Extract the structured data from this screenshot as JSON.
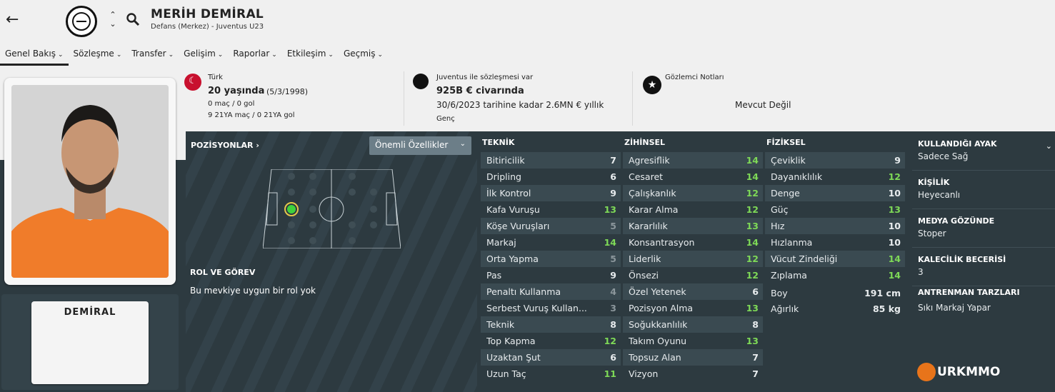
{
  "header": {
    "name": "MERİH DEMİRAL",
    "subtitle": "Defans (Merkez) - Juventus U23"
  },
  "tabs": [
    {
      "label": "Genel Bakış"
    },
    {
      "label": "Sözleşme"
    },
    {
      "label": "Transfer"
    },
    {
      "label": "Gelişim"
    },
    {
      "label": "Raporlar"
    },
    {
      "label": "Etkileşim"
    },
    {
      "label": "Geçmiş"
    }
  ],
  "nationality": {
    "country": "Türk",
    "age": "20 yaşında",
    "dob": "(5/3/1998)",
    "caps": "0 maç / 0 gol",
    "u21": "9 21YA maç / 0 21YA gol"
  },
  "contract": {
    "label": "Juventus ile sözleşmesi var",
    "value": "925B € civarında",
    "until": "30/6/2023 tarihine kadar 2.6MN € yıllık",
    "status": "Genç"
  },
  "scout": {
    "label": "Gözlemci Notları",
    "value": "Mevcut Değil"
  },
  "kit": {
    "name": "DEMİRAL"
  },
  "positions": {
    "title": "POZİSYONLAR",
    "dropdown": "Önemli Özellikler",
    "role_title": "ROL VE GÖREV",
    "role_text": "Bu mevkiye uygun bir rol yok"
  },
  "attributes": {
    "technical": {
      "title": "TEKNİK",
      "rows": [
        {
          "label": "Bitiricilik",
          "value": "7",
          "tone": "white"
        },
        {
          "label": "Dripling",
          "value": "6",
          "tone": "white"
        },
        {
          "label": "İlk Kontrol",
          "value": "9",
          "tone": "white"
        },
        {
          "label": "Kafa Vuruşu",
          "value": "13",
          "tone": "green"
        },
        {
          "label": "Köşe Vuruşları",
          "value": "5",
          "tone": "grey"
        },
        {
          "label": "Markaj",
          "value": "14",
          "tone": "green"
        },
        {
          "label": "Orta Yapma",
          "value": "5",
          "tone": "grey"
        },
        {
          "label": "Pas",
          "value": "9",
          "tone": "white"
        },
        {
          "label": "Penaltı Kullanma",
          "value": "4",
          "tone": "grey"
        },
        {
          "label": "Serbest Vuruş Kullan...",
          "value": "3",
          "tone": "grey"
        },
        {
          "label": "Teknik",
          "value": "8",
          "tone": "white"
        },
        {
          "label": "Top Kapma",
          "value": "12",
          "tone": "green"
        },
        {
          "label": "Uzaktan Şut",
          "value": "6",
          "tone": "white"
        },
        {
          "label": "Uzun Taç",
          "value": "11",
          "tone": "green"
        }
      ]
    },
    "mental": {
      "title": "ZİHİNSEL",
      "rows": [
        {
          "label": "Agresiflik",
          "value": "14",
          "tone": "green"
        },
        {
          "label": "Cesaret",
          "value": "14",
          "tone": "green"
        },
        {
          "label": "Çalışkanlık",
          "value": "12",
          "tone": "green"
        },
        {
          "label": "Karar Alma",
          "value": "12",
          "tone": "green"
        },
        {
          "label": "Kararlılık",
          "value": "13",
          "tone": "green"
        },
        {
          "label": "Konsantrasyon",
          "value": "14",
          "tone": "green"
        },
        {
          "label": "Liderlik",
          "value": "12",
          "tone": "green"
        },
        {
          "label": "Önsezi",
          "value": "12",
          "tone": "green"
        },
        {
          "label": "Özel Yetenek",
          "value": "6",
          "tone": "white"
        },
        {
          "label": "Pozisyon Alma",
          "value": "13",
          "tone": "green"
        },
        {
          "label": "Soğukkanlılık",
          "value": "8",
          "tone": "white"
        },
        {
          "label": "Takım Oyunu",
          "value": "13",
          "tone": "green"
        },
        {
          "label": "Topsuz Alan",
          "value": "7",
          "tone": "white"
        },
        {
          "label": "Vizyon",
          "value": "7",
          "tone": "white"
        }
      ]
    },
    "physical": {
      "title": "FİZİKSEL",
      "rows": [
        {
          "label": "Çeviklik",
          "value": "9",
          "tone": "white"
        },
        {
          "label": "Dayanıklılık",
          "value": "12",
          "tone": "green"
        },
        {
          "label": "Denge",
          "value": "10",
          "tone": "white"
        },
        {
          "label": "Güç",
          "value": "13",
          "tone": "green"
        },
        {
          "label": "Hız",
          "value": "10",
          "tone": "white"
        },
        {
          "label": "Hızlanma",
          "value": "10",
          "tone": "white"
        },
        {
          "label": "Vücut Zindeliği",
          "value": "14",
          "tone": "green"
        },
        {
          "label": "Zıplama",
          "value": "14",
          "tone": "green"
        }
      ],
      "height_label": "Boy",
      "height": "191 cm",
      "weight_label": "Ağırlık",
      "weight": "85 kg"
    }
  },
  "right": {
    "foot_title": "KULLANDIĞI AYAK",
    "foot": "Sadece Sağ",
    "personality_title": "KİŞİLİK",
    "personality": "Heyecanlı",
    "media_title": "MEDYA GÖZÜNDE",
    "media": "Stoper",
    "gk_title": "KALECİLİK BECERİSİ",
    "gk": "3",
    "training_title": "ANTRENMAN TARZLARI",
    "training": "Sıkı Markaj Yapar"
  },
  "logo": {
    "text": "URKMMO"
  },
  "colors": {
    "green": "#7ed957",
    "dark": "#2d3a40",
    "accent": "#e8741a"
  }
}
